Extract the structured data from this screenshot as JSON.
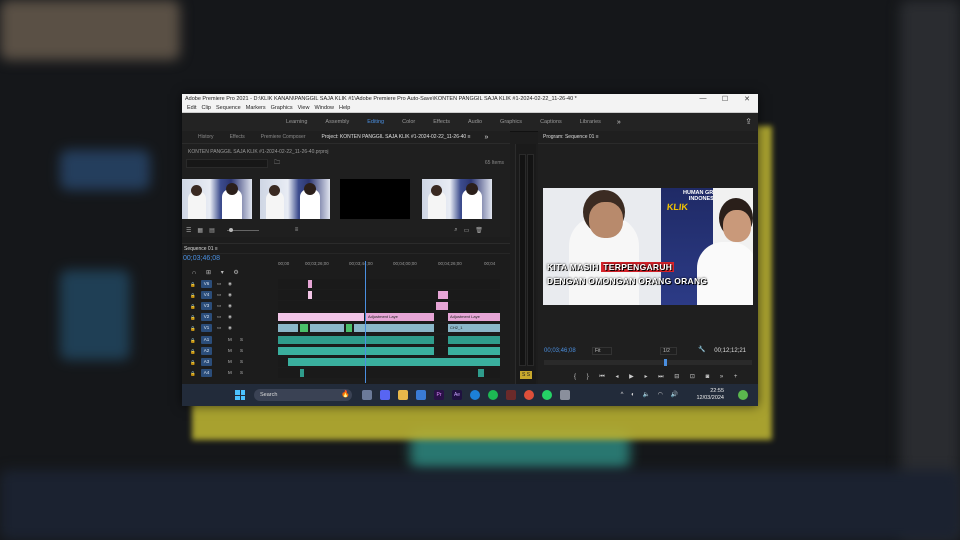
{
  "window": {
    "title": "Adobe Premiere Pro 2021 - D:\\KLIK KANAN\\PANGGIL SAJA KLIK #1\\Adobe Premiere Pro Auto-Save\\KONTEN PANGGIL SAJA KLIK #1-2024-02-22_11-26-40 *",
    "controls": {
      "minimize": "—",
      "maximize": "☐",
      "close": "✕"
    }
  },
  "menu": [
    "Edit",
    "Clip",
    "Sequence",
    "Markers",
    "Graphics",
    "View",
    "Window",
    "Help"
  ],
  "workspaces": {
    "items": [
      "Learning",
      "Assembly",
      "Editing",
      "Color",
      "Effects",
      "Audio",
      "Graphics",
      "Captions",
      "Libraries"
    ],
    "active": "Editing",
    "more": "»"
  },
  "project_panel": {
    "tabs": [
      "History",
      "Effects",
      "Premiere Composer",
      "Project: KONTEN PANGGIL SAJA KLIK #1-2024-02-22_11-26-40 ≡"
    ],
    "active_tab": 3,
    "chevron": "»",
    "file": "KONTEN PANGGIL SAJA KLIK #1-2024-02-22_11-26-40.prproj",
    "items_count": "65 Items"
  },
  "timeline": {
    "sequence_tab": "Sequence 01 ≡",
    "timecode": "00;03;46;08",
    "ruler": [
      "00;00",
      "00;03;26;00",
      "00;03;44;00",
      "00;04;00;00",
      "00;04;26;00",
      "00;04"
    ],
    "tracks": [
      {
        "name": "V6"
      },
      {
        "name": "V4"
      },
      {
        "name": "V3"
      },
      {
        "name": "V2"
      },
      {
        "name": "V1"
      },
      {
        "name": "A1"
      },
      {
        "name": "A2"
      },
      {
        "name": "A3"
      },
      {
        "name": "A4"
      }
    ],
    "clip_labels": {
      "adjustment1": "Adjustment Laye",
      "adjustment2": "Adjustment Laye",
      "v1_clip": "CH2_1"
    }
  },
  "program_monitor": {
    "tab": "Program: Sequence 01 ≡",
    "caption_line1_pre": "KITA MASIH ",
    "caption_line1_hl": "TERPENGARUH",
    "caption_line2": "DENGAN OMONGAN ORANG ORANG",
    "brand_top": "HUMAN GROUP",
    "brand_bottom": "INDONESIA",
    "brand_klik": "KLIK",
    "timecode": "00;03;46;08",
    "fit": "Fit",
    "resolution": "1/2",
    "duration": "00;12;12;21"
  },
  "taskbar": {
    "search_placeholder": "Search",
    "time": "22:55",
    "date": "12/03/2024"
  },
  "colors": {
    "accent": "#4a8fe0",
    "yellow_frame": "#b8b032",
    "caption_highlight": "#d9232b"
  }
}
